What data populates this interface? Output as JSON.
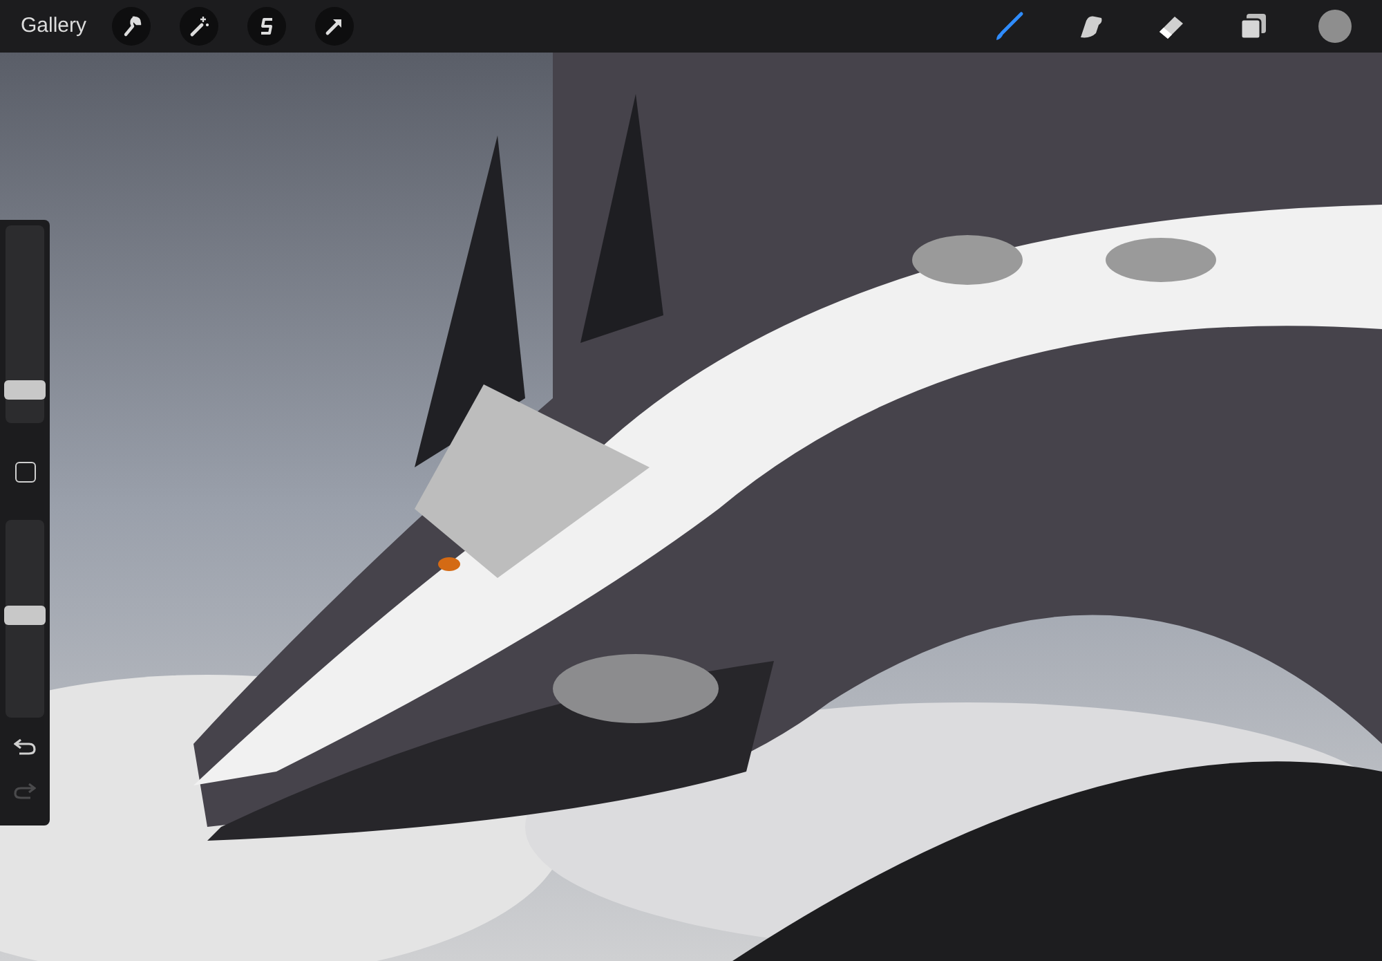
{
  "toolbar": {
    "gallery": "Gallery",
    "left_tools": [
      {
        "kind": "wrench"
      },
      {
        "kind": "wand"
      },
      {
        "kind": "selection"
      },
      {
        "kind": "arrow"
      }
    ],
    "right_tools": [
      {
        "kind": "brush",
        "selected": true
      },
      {
        "kind": "smudge",
        "selected": false
      },
      {
        "kind": "eraser",
        "selected": false
      },
      {
        "kind": "layers",
        "selected": false
      }
    ],
    "color_swatch": {
      "color": "#8e8e8e"
    }
  },
  "sidebar": {
    "size_slider": {
      "level": 0.17
    },
    "opacity_slider": {
      "level": 0.52
    },
    "undo": {
      "disabled": false
    },
    "redo": {
      "disabled": true
    }
  }
}
